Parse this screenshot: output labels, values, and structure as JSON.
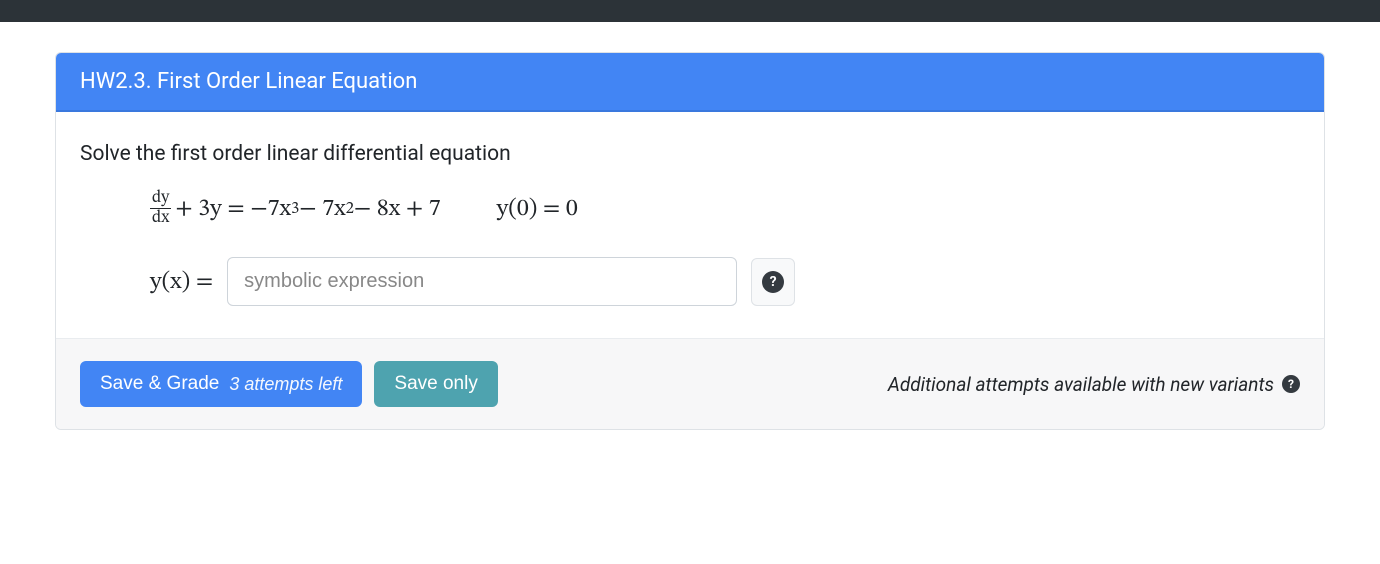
{
  "header": {
    "title": "HW2.3. First Order Linear Equation"
  },
  "body": {
    "prompt": "Solve the first order linear differential equation",
    "equation_lhs_frac_num": "dy",
    "equation_lhs_frac_den": "dx",
    "equation_lhs_rest": " + 3y = −7x",
    "equation_lhs_rest2": " − 7x",
    "equation_lhs_rest3": " − 8x + 7",
    "exp3": "3",
    "exp2": "2",
    "initial_condition": "y(0) = 0",
    "answer_label": "y(x) = ",
    "answer_placeholder": "symbolic expression",
    "answer_value": ""
  },
  "footer": {
    "save_grade_label": "Save & Grade",
    "attempts_text": "3 attempts left",
    "save_only_label": "Save only",
    "variants_text": "Additional attempts available with new variants"
  },
  "icons": {
    "help": "?",
    "info": "?"
  }
}
